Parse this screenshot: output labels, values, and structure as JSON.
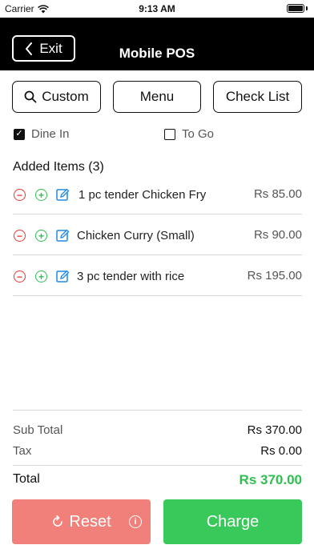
{
  "status_bar": {
    "carrier": "Carrier",
    "time": "9:13 AM"
  },
  "nav": {
    "exit_label": "Exit",
    "title": "Mobile POS"
  },
  "toolbar": {
    "custom_label": "Custom",
    "menu_label": "Menu",
    "checklist_label": "Check List"
  },
  "order_mode": {
    "dine_in": {
      "label": "Dine In",
      "checked": true
    },
    "to_go": {
      "label": "To Go",
      "checked": false
    }
  },
  "items_heading": "Added Items (3)",
  "items": [
    {
      "name": "1 pc tender Chicken Fry",
      "price": "Rs 85.00"
    },
    {
      "name": "Chicken Curry (Small)",
      "price": "Rs 90.00"
    },
    {
      "name": "3 pc tender with rice",
      "price": "Rs 195.00"
    }
  ],
  "totals": {
    "subtotal_label": "Sub Total",
    "subtotal_value": "Rs 370.00",
    "tax_label": "Tax",
    "tax_value": "Rs 0.00",
    "total_label": "Total",
    "total_value": "Rs 370.00"
  },
  "actions": {
    "reset_label": "Reset",
    "charge_label": "Charge"
  },
  "colors": {
    "accent_green": "#38c95a",
    "reset_red": "#f2807a",
    "minus_red": "#e53935",
    "edit_blue": "#1e88e5"
  }
}
